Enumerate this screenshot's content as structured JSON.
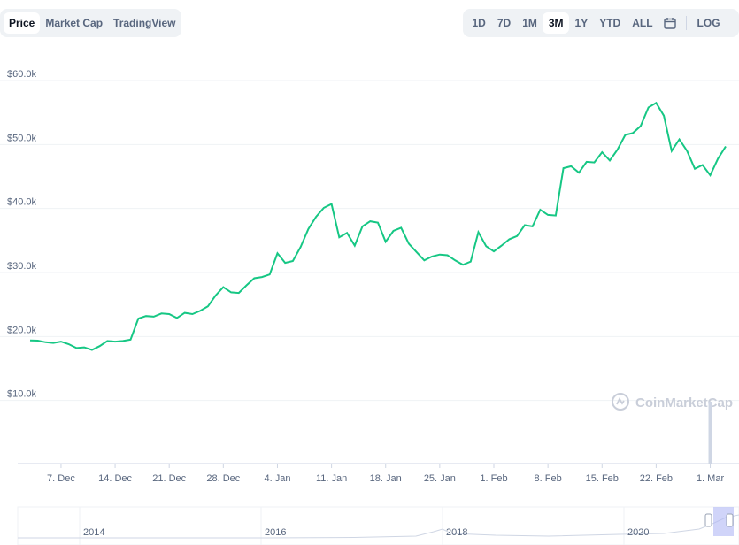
{
  "tabs": {
    "left": [
      {
        "label": "Price",
        "active": true
      },
      {
        "label": "Market Cap",
        "active": false
      },
      {
        "label": "TradingView",
        "active": false
      }
    ],
    "ranges": [
      {
        "label": "1D",
        "active": false
      },
      {
        "label": "7D",
        "active": false
      },
      {
        "label": "1M",
        "active": false
      },
      {
        "label": "3M",
        "active": true
      },
      {
        "label": "1Y",
        "active": false
      },
      {
        "label": "YTD",
        "active": false
      },
      {
        "label": "ALL",
        "active": false
      }
    ],
    "calendar_icon": "calendar-icon",
    "log_label": "LOG"
  },
  "watermark": "CoinMarketCap",
  "colors": {
    "line": "#16c784",
    "grid": "#eff2f5",
    "axis_text": "#58667e",
    "volume": "#cfd6e4",
    "navigator_handle": "#b0b8f5"
  },
  "chart_data": {
    "type": "line",
    "title": "",
    "xlabel": "",
    "ylabel": "",
    "ylim": [
      0,
      62000
    ],
    "y_ticks": [
      10000,
      20000,
      30000,
      40000,
      50000,
      60000
    ],
    "y_tick_labels": [
      "$10.0k",
      "$20.0k",
      "$30.0k",
      "$40.0k",
      "$50.0k",
      "$60.0k"
    ],
    "x_ticks": [
      "2020-12-07",
      "2020-12-14",
      "2020-12-21",
      "2020-12-28",
      "2021-01-04",
      "2021-01-11",
      "2021-01-18",
      "2021-01-25",
      "2021-02-01",
      "2021-02-08",
      "2021-02-15",
      "2021-02-22",
      "2021-03-01"
    ],
    "x_tick_labels": [
      "7. Dec",
      "14. Dec",
      "21. Dec",
      "28. Dec",
      "4. Jan",
      "11. Jan",
      "18. Jan",
      "25. Jan",
      "1. Feb",
      "8. Feb",
      "15. Feb",
      "22. Feb",
      "1. Mar"
    ],
    "grid": true,
    "series": [
      {
        "x_start": "2020-12-03",
        "step_days": 1,
        "values": [
          19400,
          19350,
          19100,
          19000,
          19200,
          18800,
          18200,
          18300,
          17900,
          18500,
          19300,
          19200,
          19300,
          19500,
          22800,
          23200,
          23100,
          23600,
          23500,
          22900,
          23700,
          23500,
          24000,
          24700,
          26400,
          27700,
          26900,
          26800,
          28000,
          29100,
          29300,
          29700,
          33000,
          31500,
          31800,
          34000,
          36800,
          38700,
          40100,
          40700,
          35500,
          36200,
          34200,
          37200,
          38000,
          37800,
          34800,
          36500,
          37000,
          34500,
          33200,
          31900,
          32500,
          32800,
          32700,
          31900,
          31200,
          31700,
          36300,
          34100,
          33300,
          34200,
          35200,
          35700,
          37400,
          37200,
          39800,
          39000,
          38900,
          46300,
          46600,
          45600,
          47300,
          47200,
          48800,
          47500,
          49200,
          51500,
          51800,
          52900,
          55800,
          56500,
          54500,
          49000,
          50800,
          49000,
          46200,
          46800,
          45200,
          47800,
          49700
        ]
      }
    ],
    "volume": {
      "max": 8500,
      "points": [
        {
          "x": "2021-03-01",
          "v": 8500
        }
      ]
    },
    "navigator": {
      "tick_labels": [
        "2014",
        "2016",
        "2018",
        "2020"
      ]
    }
  }
}
